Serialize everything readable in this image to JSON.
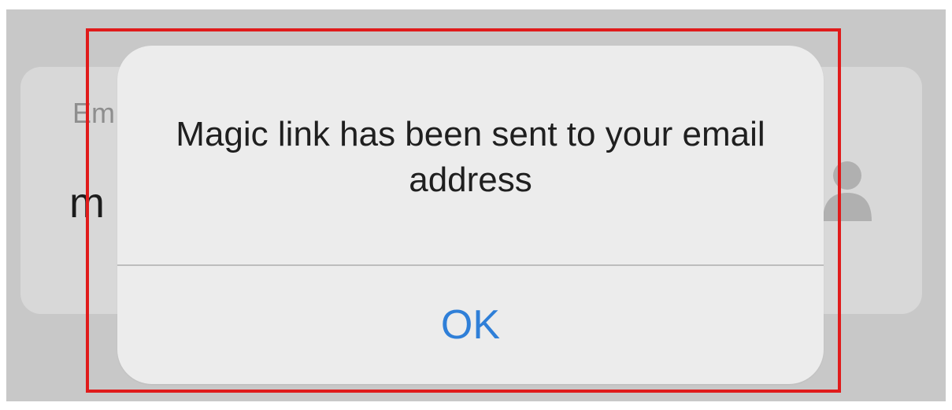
{
  "background_field": {
    "label_visible": "Em",
    "value_visible": "m",
    "icon": "user-icon"
  },
  "alert": {
    "message": "Magic link has been sent to your email address",
    "button_label": "OK"
  },
  "colors": {
    "highlight": "#e01b1b",
    "button_text": "#2f7fd8",
    "dialog_bg": "#ececec",
    "dim_bg": "#c8c8c8"
  }
}
